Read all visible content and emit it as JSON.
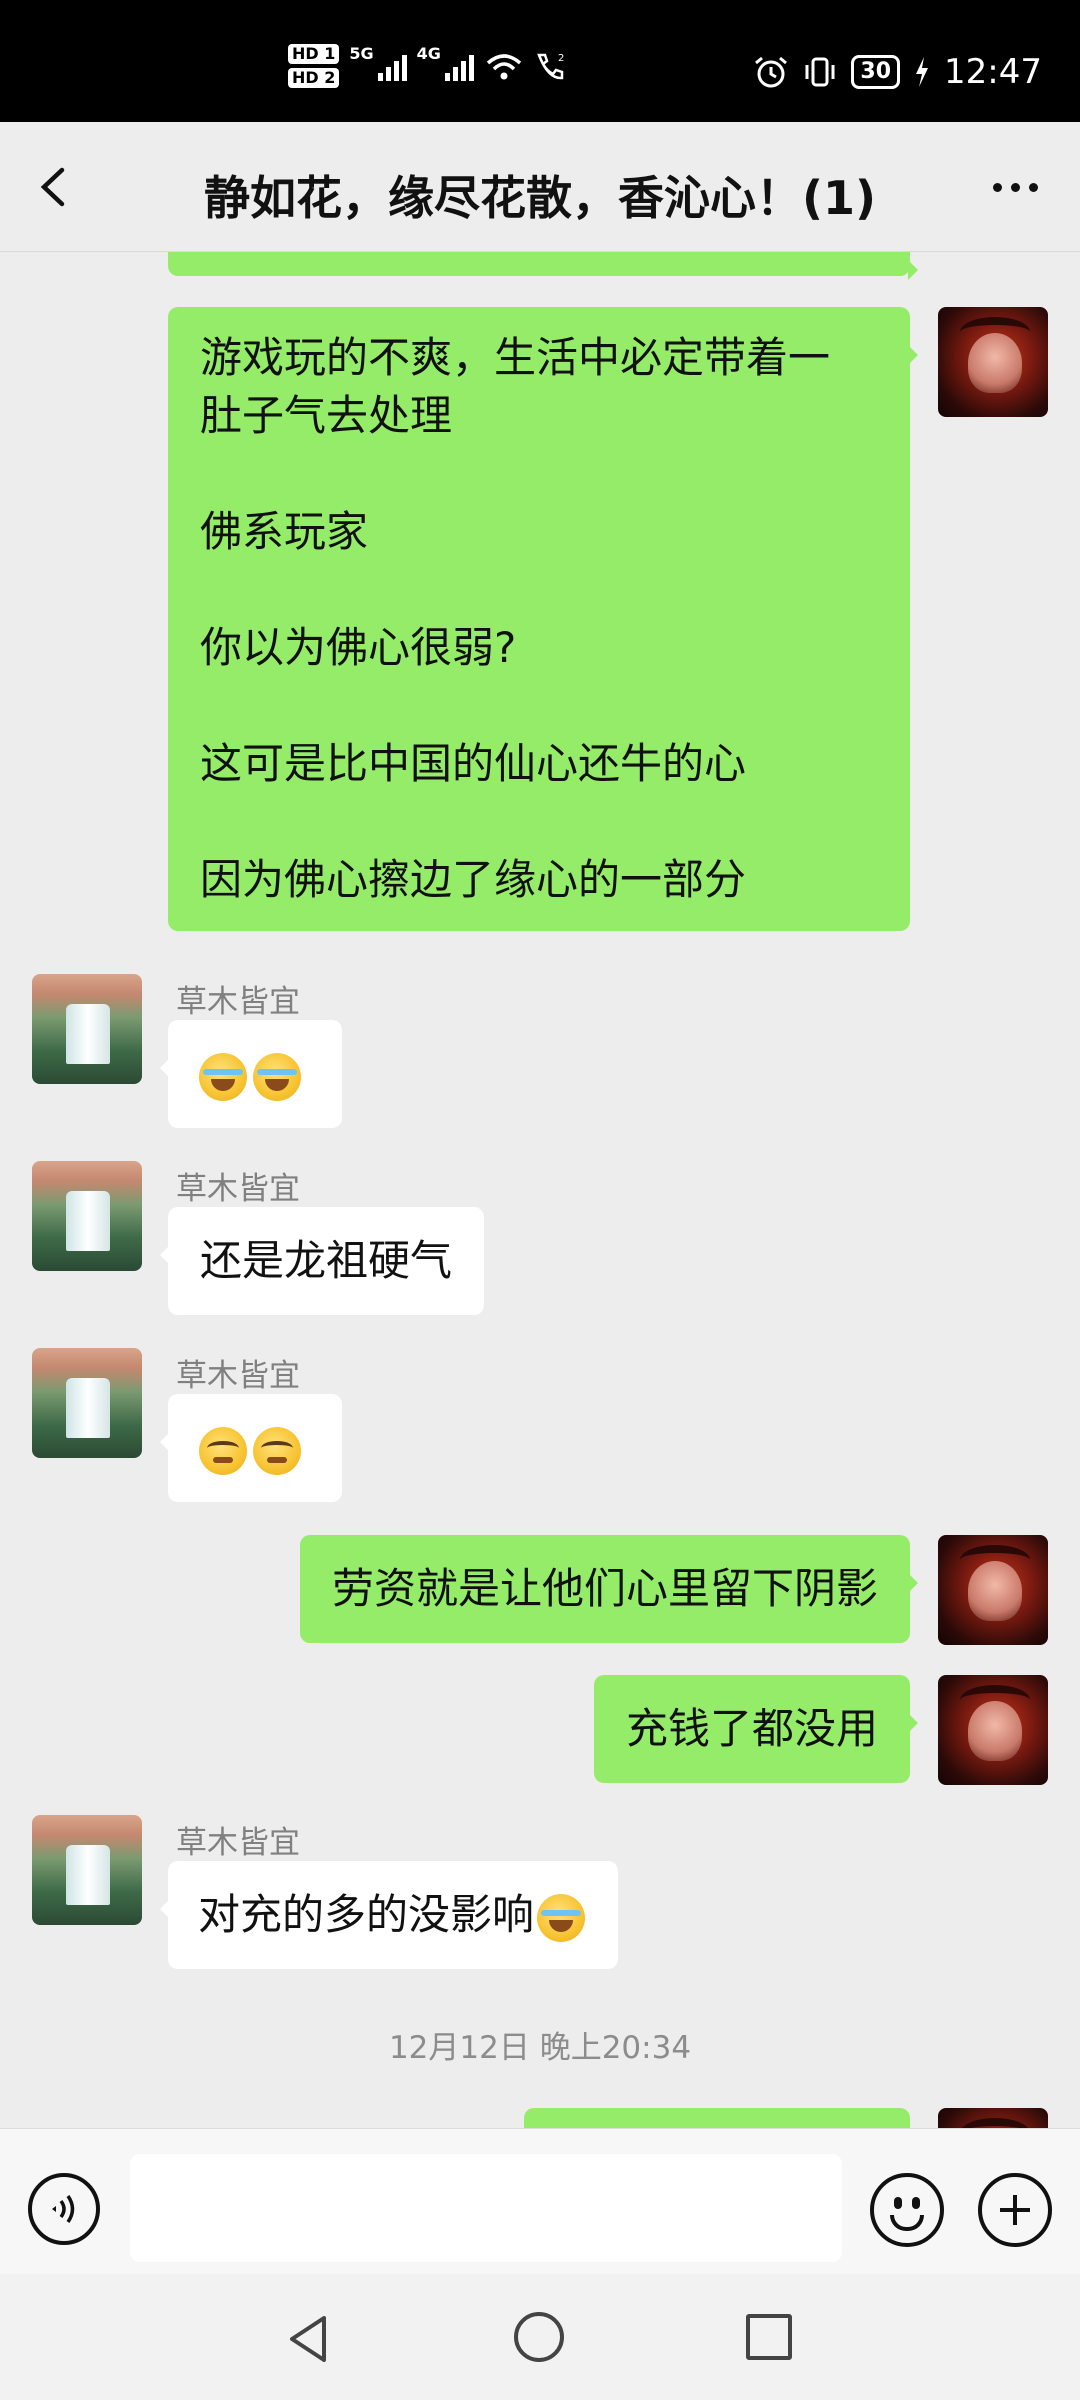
{
  "status_bar": {
    "hd1": "HD 1",
    "hd2": "HD 2",
    "net_5g": "5G",
    "net_4g": "4G",
    "battery": "30",
    "time": "12:47"
  },
  "header": {
    "title": "静如花，缘尽花散，香沁心！(1)"
  },
  "messages": [
    {
      "side": "mine",
      "lines": [
        "游戏玩的不爽，生活中必定带着一",
        "肚子气去处理",
        "",
        "佛系玩家",
        "",
        "你以为佛心很弱?",
        "",
        "这可是比中国的仙心还牛的心",
        "",
        "因为佛心擦边了缘心的一部分"
      ]
    },
    {
      "side": "other",
      "sender": "草木皆宜",
      "emoji": [
        "cry-laugh",
        "cry-laugh"
      ]
    },
    {
      "side": "other",
      "sender": "草木皆宜",
      "text": "还是龙祖硬气"
    },
    {
      "side": "other",
      "sender": "草木皆宜",
      "emoji": [
        "smirk",
        "smirk"
      ]
    },
    {
      "side": "mine",
      "text": "劳资就是让他们心里留下阴影"
    },
    {
      "side": "mine",
      "text": "充钱了都没用"
    },
    {
      "side": "other",
      "sender": "草木皆宜",
      "text": "对充的多的没影响"
    }
  ],
  "timestamp": "12月12日 晚上20:34",
  "input_bar": {
    "voice_icon": "voice-icon",
    "emoji_icon": "emoji-icon",
    "plus_icon": "plus-icon"
  }
}
